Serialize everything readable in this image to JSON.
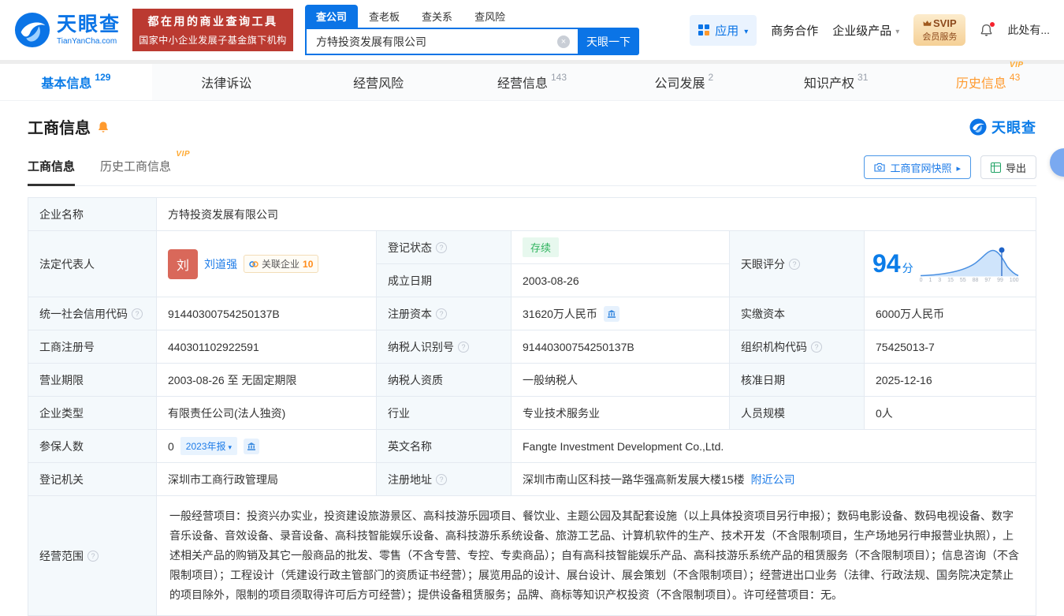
{
  "header": {
    "logo": {
      "title": "天眼查",
      "subtitle": "TianYanCha.com"
    },
    "banner": {
      "line1": "都在用的商业查询工具",
      "line2": "国家中小企业发展子基金旗下机构"
    },
    "search_tabs": [
      {
        "label": "查公司"
      },
      {
        "label": "查老板"
      },
      {
        "label": "查关系"
      },
      {
        "label": "查风险"
      }
    ],
    "search": {
      "value": "方特投资发展有限公司",
      "button": "天眼一下"
    },
    "nav": {
      "apps": "应用",
      "business": "商务合作",
      "enterprise": "企业级产品",
      "svip_line1": "SVIP",
      "svip_line2": "会员服务",
      "account": "此处有..."
    }
  },
  "tabs": [
    {
      "label": "基本信息",
      "count": "129"
    },
    {
      "label": "法律诉讼",
      "count": ""
    },
    {
      "label": "经营风险",
      "count": ""
    },
    {
      "label": "经营信息",
      "count": "143"
    },
    {
      "label": "公司发展",
      "count": "2"
    },
    {
      "label": "知识产权",
      "count": "31"
    },
    {
      "label": "历史信息",
      "count": "43",
      "vip": "VIP"
    }
  ],
  "section": {
    "title": "工商信息",
    "brand": "天眼查",
    "subtabs": [
      {
        "label": "工商信息"
      },
      {
        "label": "历史工商信息",
        "vip": "VIP"
      }
    ],
    "snapshot_button": "工商官网快照",
    "export_button": "导出"
  },
  "table": {
    "company_name": {
      "label": "企业名称",
      "value": "方特投资发展有限公司"
    },
    "legal_rep": {
      "label": "法定代表人",
      "avatar": "刘",
      "name": "刘道强",
      "related": "关联企业",
      "related_count": "10"
    },
    "reg_status": {
      "label": "登记状态",
      "value": "存续"
    },
    "establish_date": {
      "label": "成立日期",
      "value": "2003-08-26"
    },
    "score": {
      "label": "天眼评分",
      "value": "94",
      "unit": "分",
      "ticks": [
        "0",
        "1",
        "3",
        "15",
        "55",
        "88",
        "97",
        "99",
        "100"
      ]
    },
    "credit_code": {
      "label": "统一社会信用代码",
      "value": "91440300754250137B"
    },
    "reg_capital": {
      "label": "注册资本",
      "value": "31620万人民币"
    },
    "paid_capital": {
      "label": "实缴资本",
      "value": "6000万人民币"
    },
    "reg_number": {
      "label": "工商注册号",
      "value": "440301102922591"
    },
    "taxpayer_id": {
      "label": "纳税人识别号",
      "value": "91440300754250137B"
    },
    "org_code": {
      "label": "组织机构代码",
      "value": "75425013-7"
    },
    "term": {
      "label": "营业期限",
      "value": "2003-08-26 至 无固定期限"
    },
    "taxpayer_quality": {
      "label": "纳税人资质",
      "value": "一般纳税人"
    },
    "approval_date": {
      "label": "核准日期",
      "value": "2025-12-16"
    },
    "company_type": {
      "label": "企业类型",
      "value": "有限责任公司(法人独资)"
    },
    "industry": {
      "label": "行业",
      "value": "专业技术服务业"
    },
    "staff": {
      "label": "人员规模",
      "value": "0人"
    },
    "insured": {
      "label": "参保人数",
      "value": "0",
      "badge": "2023年报"
    },
    "english_name": {
      "label": "英文名称",
      "value": "Fangte Investment Development Co.,Ltd."
    },
    "authority": {
      "label": "登记机关",
      "value": "深圳市工商行政管理局"
    },
    "address": {
      "label": "注册地址",
      "value": "深圳市南山区科技一路华强高新发展大楼15楼",
      "nearby": "附近公司"
    },
    "scope": {
      "label": "经营范围",
      "value": "一般经营项目：投资兴办实业，投资建设旅游景区、高科技游乐园项目、餐饮业、主题公园及其配套设施（以上具体投资项目另行申报）；数码电影设备、数码电视设备、数字音乐设备、音效设备、录音设备、高科技智能娱乐设备、高科技游乐系统设备、旅游工艺品、计算机软件的生产、技术开发（不含限制项目，生产场地另行申报营业执照），上述相关产品的购销及其它一般商品的批发、零售（不含专营、专控、专卖商品）；自有高科技智能娱乐产品、高科技游乐系统产品的租赁服务（不含限制项目）；信息咨询（不含限制项目）；工程设计（凭建设行政主管部门的资质证书经营）；展览用品的设计、展台设计、展会策划（不含限制项目）；经营进出口业务（法律、行政法规、国务院决定禁止的项目除外，限制的项目须取得许可后方可经营）；提供设备租赁服务；品牌、商标等知识产权投资（不含限制项目）。许可经营项目：无。"
    }
  },
  "colors": {
    "brand_blue": "#0b74e6",
    "banner_red": "#bb3a31",
    "vip_orange": "#ff9a2e",
    "status_green": "#2fb35e"
  }
}
